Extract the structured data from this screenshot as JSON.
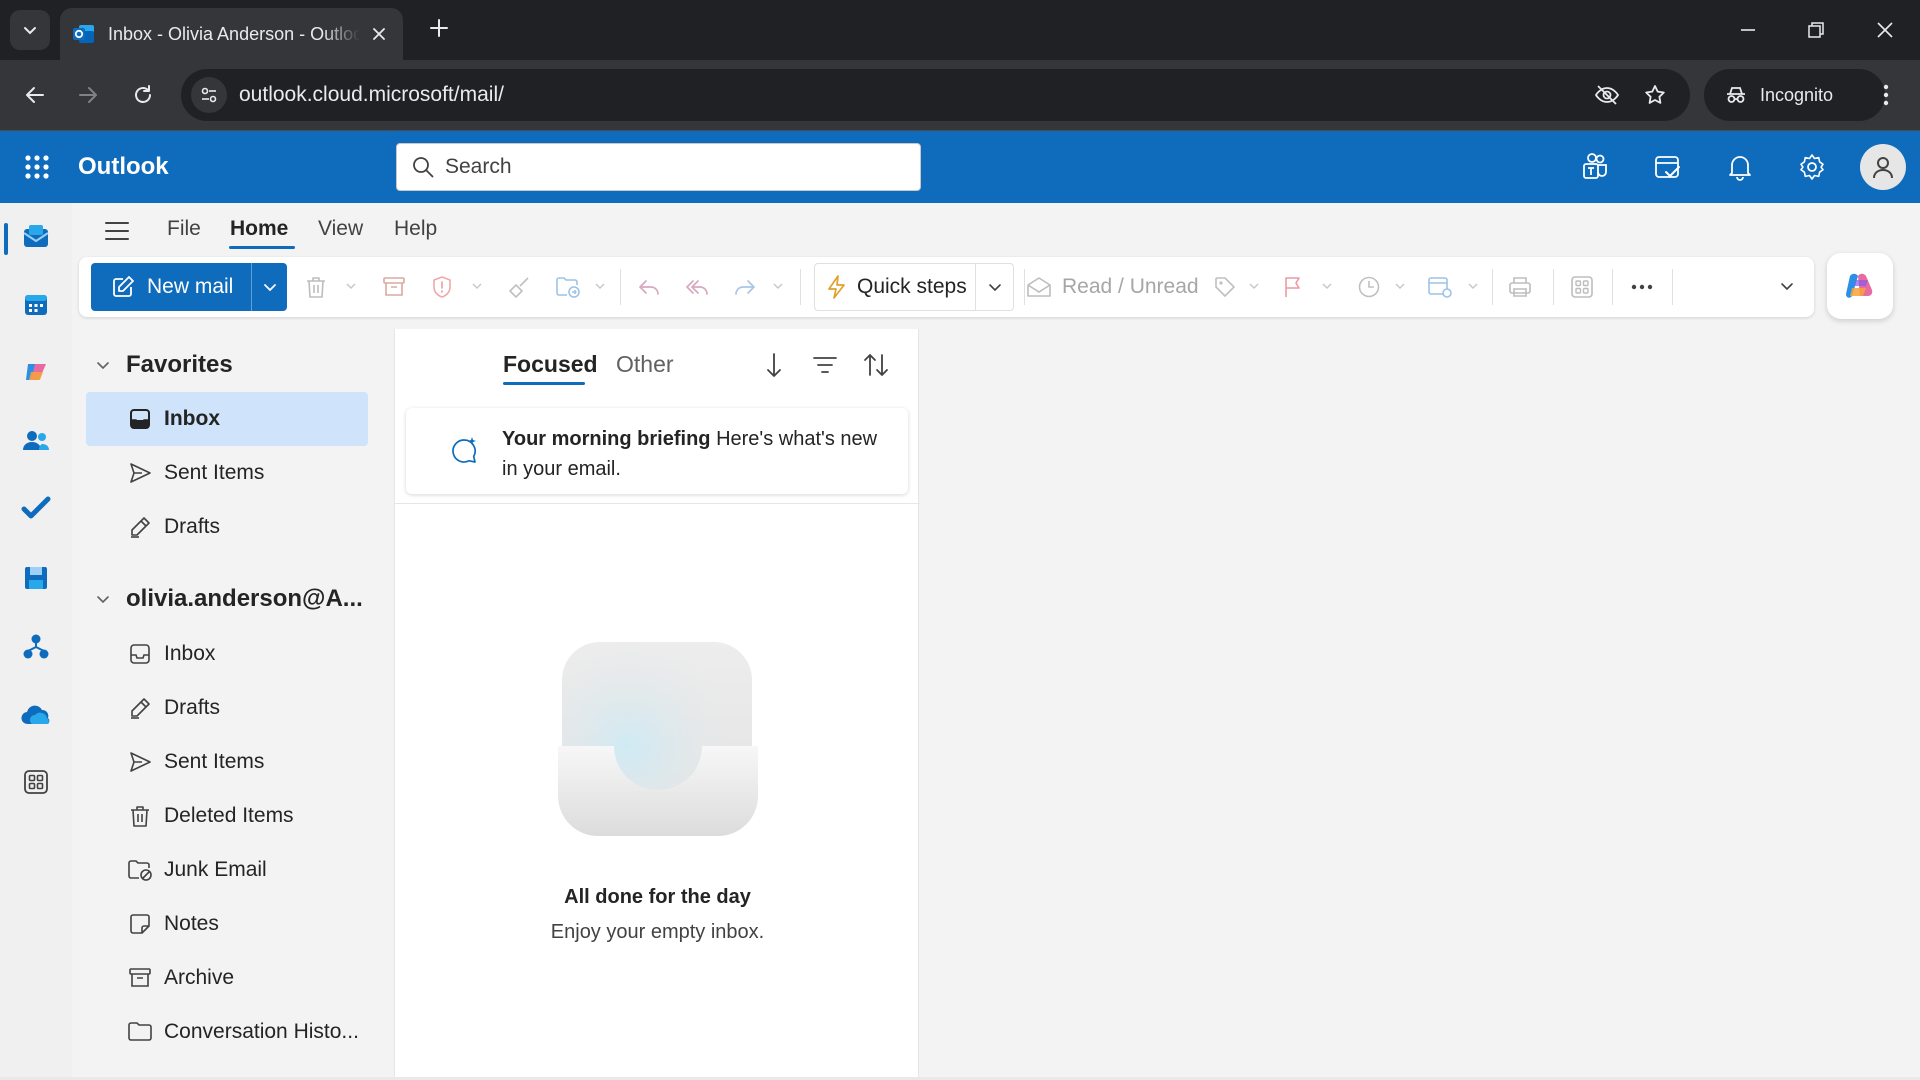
{
  "browser": {
    "tab_title": "Inbox - Olivia Anderson - Outlook",
    "url": "outlook.cloud.microsoft/mail/",
    "incognito_label": "Incognito"
  },
  "header": {
    "app_name": "Outlook",
    "search_placeholder": "Search",
    "brand_color": "#0f6cbd"
  },
  "rail": {
    "items": [
      "mail-icon",
      "calendar-icon",
      "copilot-icon",
      "people-icon",
      "todo-icon",
      "save-icon",
      "org-explorer-icon",
      "onedrive-icon",
      "more-apps-icon"
    ],
    "active": "mail-icon"
  },
  "ribbon": {
    "menu": [
      "File",
      "Home",
      "View",
      "Help"
    ],
    "active_menu": "Home",
    "new_mail": "New mail",
    "quick_steps": "Quick steps",
    "read_unread": "Read / Unread"
  },
  "folders": {
    "favorites_label": "Favorites",
    "favorites": [
      {
        "label": "Inbox",
        "icon": "inbox-icon",
        "selected": true
      },
      {
        "label": "Sent Items",
        "icon": "send-icon"
      },
      {
        "label": "Drafts",
        "icon": "drafts-icon"
      }
    ],
    "account_label": "olivia.anderson@A...",
    "account_folders": [
      {
        "label": "Inbox",
        "icon": "inbox-icon"
      },
      {
        "label": "Drafts",
        "icon": "drafts-icon"
      },
      {
        "label": "Sent Items",
        "icon": "send-icon"
      },
      {
        "label": "Deleted Items",
        "icon": "trash-icon"
      },
      {
        "label": "Junk Email",
        "icon": "junk-icon"
      },
      {
        "label": "Notes",
        "icon": "note-icon"
      },
      {
        "label": "Archive",
        "icon": "archive-icon"
      },
      {
        "label": "Conversation Histo...",
        "icon": "folder-icon"
      }
    ]
  },
  "message_list": {
    "focused_tab": "Focused",
    "other_tab": "Other",
    "briefing_title": "Your morning briefing",
    "briefing_body": "Here's what's new in your email.",
    "empty_title": "All done for the day",
    "empty_subtitle": "Enjoy your empty inbox."
  }
}
